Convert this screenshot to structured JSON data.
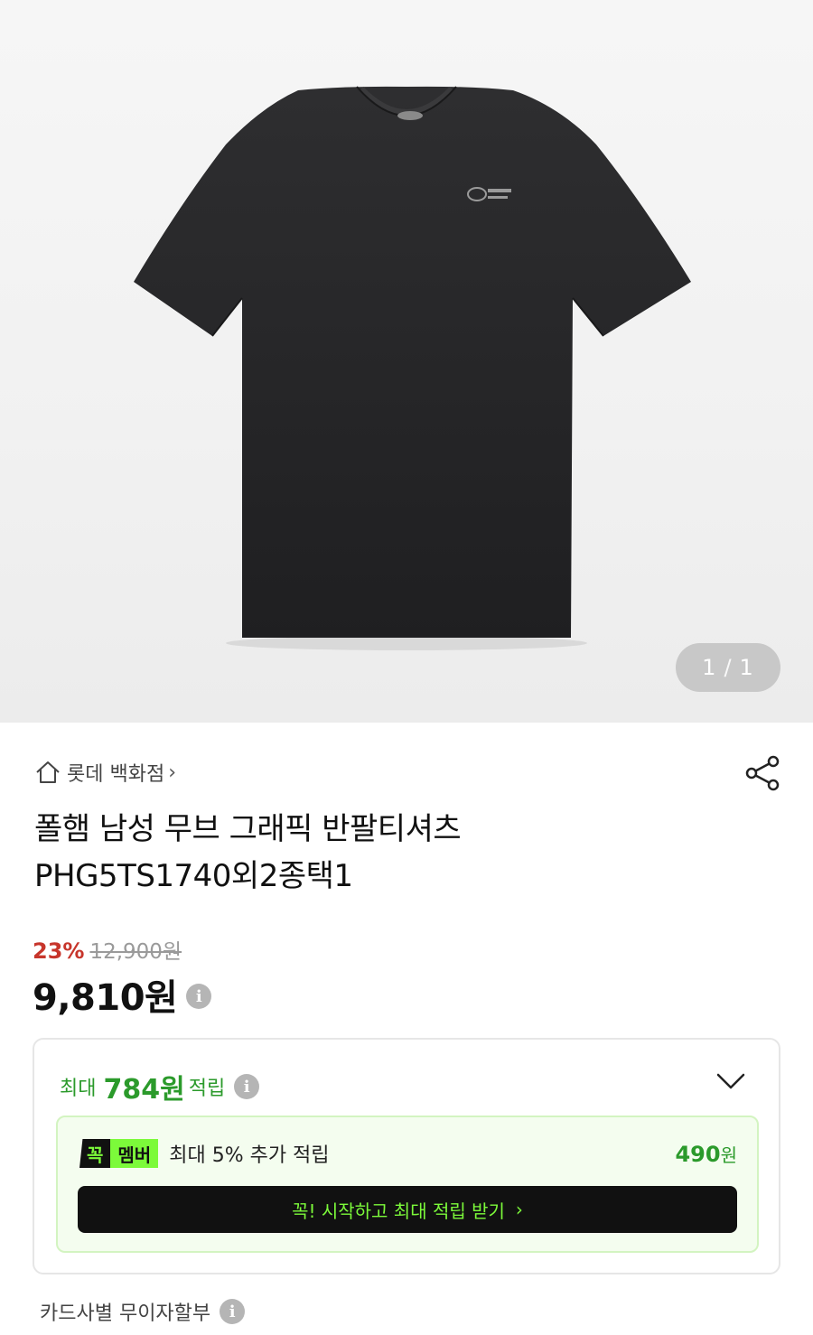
{
  "gallery": {
    "current": "1",
    "separator": "/",
    "total": "1"
  },
  "store": {
    "icon": "home-icon",
    "name": "롯데 백화점",
    "chevron": "›"
  },
  "share": {
    "icon": "share-icon"
  },
  "product": {
    "title_line1": "폴햄 남성 무브 그래픽 반팔티셔츠",
    "title_line2": "PHG5TS1740외2종택1"
  },
  "pricing": {
    "discount": "23%",
    "original_price": "12,900원",
    "sale_price": "9,810원",
    "info_icon": "i"
  },
  "points": {
    "prefix": "최대",
    "amount": "784원",
    "suffix": "적립",
    "info_icon": "i",
    "toggle_icon": "chevron-down-icon"
  },
  "membership": {
    "badge_part1": "꼭",
    "badge_part2": "멤버",
    "description": "최대 5% 추가 적립",
    "amount": "490",
    "amount_unit": "원",
    "cta_label": "꼭! 시작하고 최대 적립 받기",
    "cta_arrow": "›"
  },
  "installment": {
    "label": "카드사별 무이자할부",
    "info_icon": "i"
  },
  "colors": {
    "discount": "#c7352b",
    "points_green": "#2b9a2b",
    "member_neon": "#7cfa3a",
    "member_bg": "#f4fdef"
  }
}
